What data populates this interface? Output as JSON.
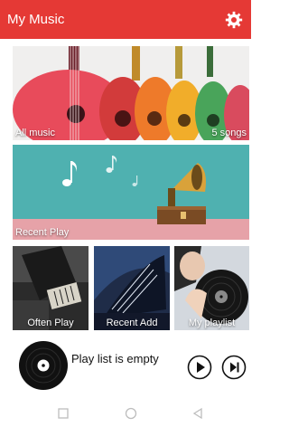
{
  "appbar": {
    "title": "My Music",
    "settings_icon": "gear-icon"
  },
  "tiles": {
    "all_music": {
      "label": "All music",
      "count": "5 songs"
    },
    "recent_play": {
      "label": "Recent Play"
    },
    "often_play": {
      "label": "Often Play"
    },
    "recent_add": {
      "label": "Recent Add"
    },
    "my_playlist": {
      "label": "My playlist"
    }
  },
  "player": {
    "status": "Play list is empty",
    "play_icon": "play-icon",
    "next_icon": "skip-next-icon"
  },
  "navbar": {
    "icons": [
      "square-icon",
      "circle-icon",
      "triangle-back-icon"
    ]
  },
  "colors": {
    "accent": "#e53935"
  }
}
